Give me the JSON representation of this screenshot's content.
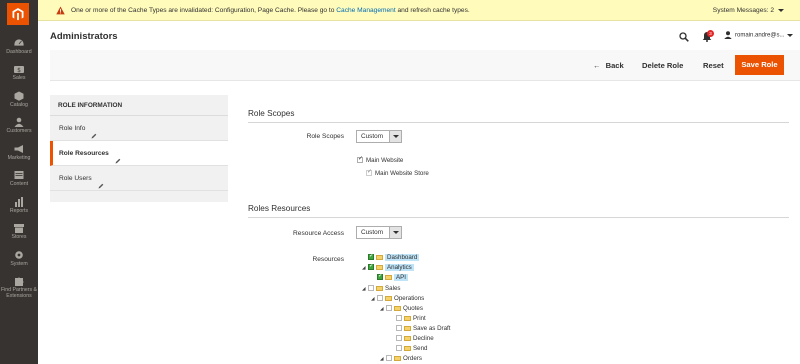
{
  "system_message": {
    "text_before": "One or more of the Cache Types are invalidated: Configuration, Page Cache. Please go to",
    "link": "Cache Management",
    "text_after": "and refresh cache types.",
    "counter": "System Messages: 2"
  },
  "nav": {
    "items": [
      {
        "label": "Dashboard",
        "icon": "dashboard-icon"
      },
      {
        "label": "Sales",
        "icon": "dollar-icon"
      },
      {
        "label": "Catalog",
        "icon": "cube-icon"
      },
      {
        "label": "Customers",
        "icon": "users-icon"
      },
      {
        "label": "Marketing",
        "icon": "megaphone-icon"
      },
      {
        "label": "Content",
        "icon": "layout-icon"
      },
      {
        "label": "Reports",
        "icon": "bar-chart-icon"
      },
      {
        "label": "Stores",
        "icon": "store-icon"
      },
      {
        "label": "System",
        "icon": "gear-icon"
      },
      {
        "label": "Find Partners & Extensions",
        "icon": "puzzle-icon"
      }
    ]
  },
  "header": {
    "title": "Administrators",
    "notification_count": "3",
    "user": "romain.andre@s..."
  },
  "actions": {
    "back": "Back",
    "delete": "Delete Role",
    "reset": "Reset",
    "save": "Save Role"
  },
  "tabs": {
    "title": "ROLE INFORMATION",
    "items": [
      "Role Info",
      "Role Resources",
      "Role Users"
    ],
    "active": "Role Resources"
  },
  "role_scopes": {
    "title": "Role Scopes",
    "label": "Role Scopes",
    "value": "Custom",
    "website": "Main Website",
    "store": "Main Website Store"
  },
  "roles_resources": {
    "title": "Roles Resources",
    "access_label": "Resource Access",
    "access_value": "Custom",
    "resources_label": "Resources",
    "tree": [
      {
        "label": "Dashboard",
        "checked": true
      },
      {
        "label": "Analytics",
        "checked": true
      },
      {
        "label": "API",
        "checked": true
      },
      {
        "label": "Sales",
        "checked": false
      },
      {
        "label": "Operations",
        "checked": false
      },
      {
        "label": "Quotes",
        "checked": false
      },
      {
        "label": "Print",
        "checked": false
      },
      {
        "label": "Save as Draft",
        "checked": false
      },
      {
        "label": "Decline",
        "checked": false
      },
      {
        "label": "Send",
        "checked": false
      },
      {
        "label": "Orders",
        "checked": false
      }
    ]
  },
  "colors": {
    "accent": "#eb5202",
    "nav_bg": "#373330",
    "message_bg": "#fffbbb",
    "link": "#006bb4"
  }
}
